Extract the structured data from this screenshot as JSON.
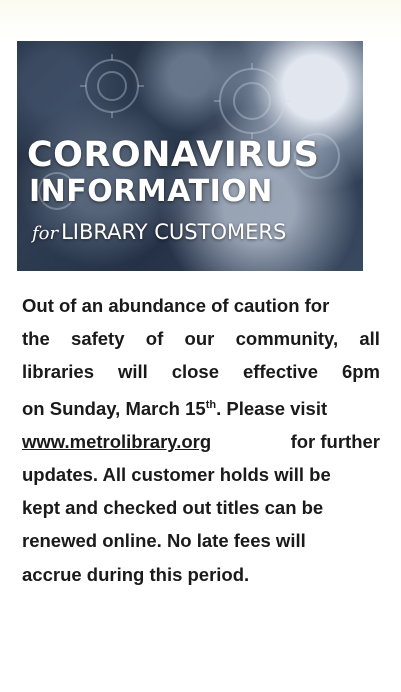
{
  "banner": {
    "title": "CORONAVIRUS",
    "subtitle": "INFORMATION",
    "for_word": "for",
    "audience": "LIBRARY CUSTOMERS"
  },
  "notice": {
    "line1": "Out of an abundance of caution for",
    "line2_w1": "the",
    "line2_w2": "safety",
    "line2_w3": "of",
    "line2_w4": "our",
    "line2_w5": "community,",
    "line2_w6": "all",
    "line3_w1": "libraries",
    "line3_w2": "will",
    "line3_w3": "close",
    "line3_w4": "effective",
    "line3_w5": "6pm",
    "line4_a": "on Sunday, March 15",
    "line4_sup": "th",
    "line4_b": ". Please visit",
    "line5_link": "www.metrolibrary.org",
    "line5_rest": "for further",
    "line6": "updates. All customer holds will be",
    "line7": "kept and checked out titles can be",
    "line8": "renewed online. No late fees will",
    "line9": "accrue during this period."
  }
}
